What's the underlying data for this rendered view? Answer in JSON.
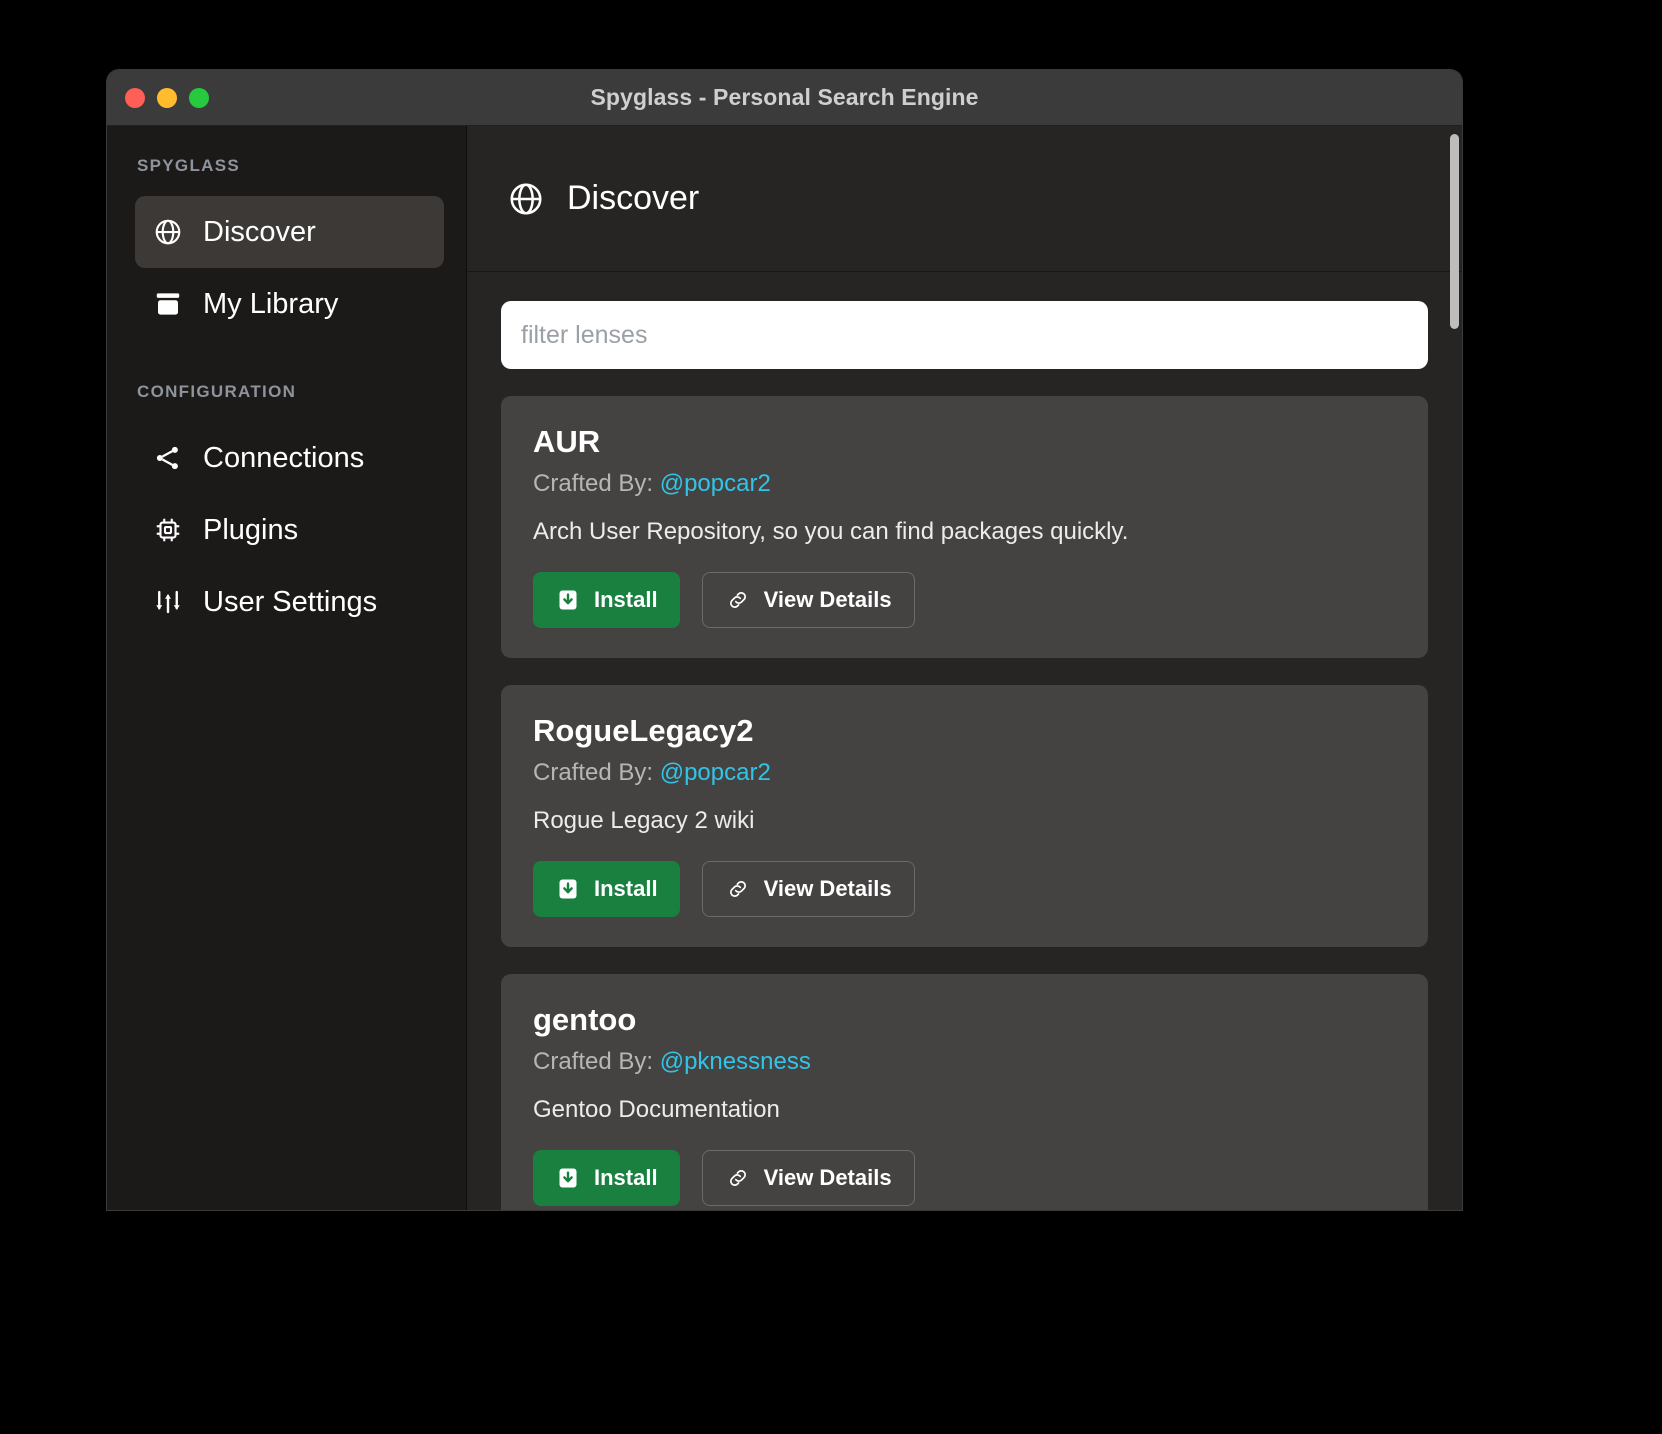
{
  "window": {
    "title": "Spyglass - Personal Search Engine",
    "traffic_lights": [
      {
        "name": "close",
        "color": "#ff5f56"
      },
      {
        "name": "minimize",
        "color": "#ffbd2e"
      },
      {
        "name": "maximize",
        "color": "#27c93f"
      }
    ]
  },
  "sidebar": {
    "sections": [
      {
        "label": "SPYGLASS",
        "items": [
          {
            "label": "Discover",
            "icon": "globe-icon",
            "active": true
          },
          {
            "label": "My Library",
            "icon": "archive-icon",
            "active": false
          }
        ]
      },
      {
        "label": "CONFIGURATION",
        "items": [
          {
            "label": "Connections",
            "icon": "share-icon",
            "active": false
          },
          {
            "label": "Plugins",
            "icon": "chip-icon",
            "active": false
          },
          {
            "label": "User Settings",
            "icon": "sliders-icon",
            "active": false
          }
        ]
      }
    ]
  },
  "main": {
    "header": {
      "title": "Discover",
      "icon": "globe-icon"
    },
    "filter": {
      "placeholder": "filter lenses",
      "value": ""
    },
    "buttons": {
      "install_label": "Install",
      "details_label": "View Details",
      "install_icon": "file-download-icon",
      "details_icon": "link-icon"
    },
    "author_prefix": "Crafted By:",
    "lenses": [
      {
        "name": "AUR",
        "author": "@popcar2",
        "description": "Arch User Repository, so you can find packages quickly."
      },
      {
        "name": "RogueLegacy2",
        "author": "@popcar2",
        "description": "Rogue Legacy 2 wiki"
      },
      {
        "name": "gentoo",
        "author": "@pknessness",
        "description": "Gentoo Documentation"
      }
    ]
  },
  "colors": {
    "accent_green": "#198040",
    "link_cyan": "#31c4e8",
    "sidebar_bg": "#1c1a19",
    "main_bg": "#262524",
    "card_bg": "#454342"
  }
}
